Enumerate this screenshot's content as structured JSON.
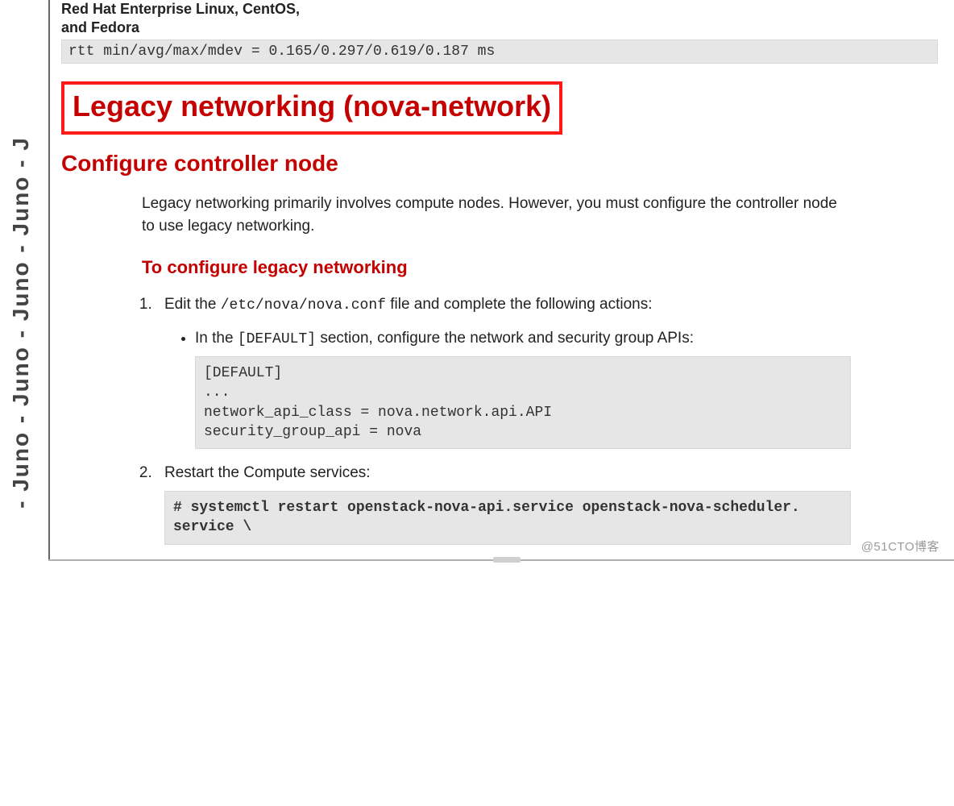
{
  "side_ribbon": "- Juno - Juno - Juno - Juno - J",
  "os_note_line1": "Red Hat Enterprise Linux, CentOS,",
  "os_note_line2": "and Fedora",
  "rtt_line": "rtt min/avg/max/mdev = 0.165/0.297/0.619/0.187 ms",
  "h1_title": "Legacy networking (nova-network)",
  "h2_sub": "Configure controller node",
  "intro_para": "Legacy networking primarily involves compute nodes. However, you must configure the controller node to use legacy networking.",
  "h3_step": "To configure legacy networking",
  "step1_lead_before": "Edit the ",
  "step1_path": "/etc/nova/nova.conf",
  "step1_lead_after": " file and complete the following actions:",
  "step1_bullet_before": "In the ",
  "step1_bullet_code": "[DEFAULT]",
  "step1_bullet_after": " section, configure the network and security group APIs:",
  "step1_codeblock": "[DEFAULT]\n...\nnetwork_api_class = nova.network.api.API\nsecurity_group_api = nova",
  "step2_text": "Restart the Compute services:",
  "step2_cmd_prefix": "# ",
  "step2_cmd_line1": "systemctl restart openstack-nova-api.service openstack-nova-scheduler.",
  "step2_cmd_line2": "service \\",
  "watermark": "@51CTO博客"
}
